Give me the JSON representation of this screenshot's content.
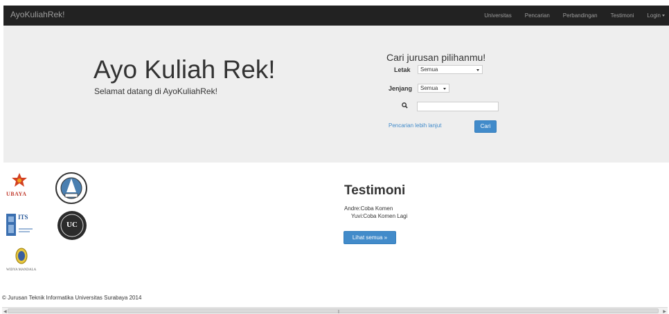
{
  "navbar": {
    "brand": "AyoKuliahRek!",
    "links": [
      "Universitas",
      "Pencarian",
      "Perbandingan",
      "Testimoni"
    ],
    "login_label": "Login"
  },
  "jumbotron": {
    "title": "Ayo Kuliah Rek!",
    "subtitle": "Selamat datang di AyoKuliahRek!"
  },
  "search": {
    "title": "Cari jurusan pilihanmu!",
    "letak_label": "Letak",
    "letak_value": "Semua",
    "jenjang_label": "Jenjang",
    "jenjang_value": "Semua",
    "query_value": "",
    "advanced_link": "Pencarian lebih lanjut",
    "submit_label": "Cari"
  },
  "logos": {
    "ubaya": "UBAYA",
    "its": "ITS",
    "ukwm": "WIDYA MANDALA",
    "uc": "UC"
  },
  "testimoni": {
    "title": "Testimoni",
    "items": [
      "Andre:Coba Komen",
      "Yuvi:Coba Komen Lagi"
    ],
    "more_label": "Lihat semua »"
  },
  "footer": {
    "text": "© Jurusan Teknik Informatika Universitas Surabaya 2014"
  },
  "colors": {
    "navbar_bg": "#222222",
    "jumbotron_bg": "#eeeeee",
    "primary": "#428bca"
  }
}
